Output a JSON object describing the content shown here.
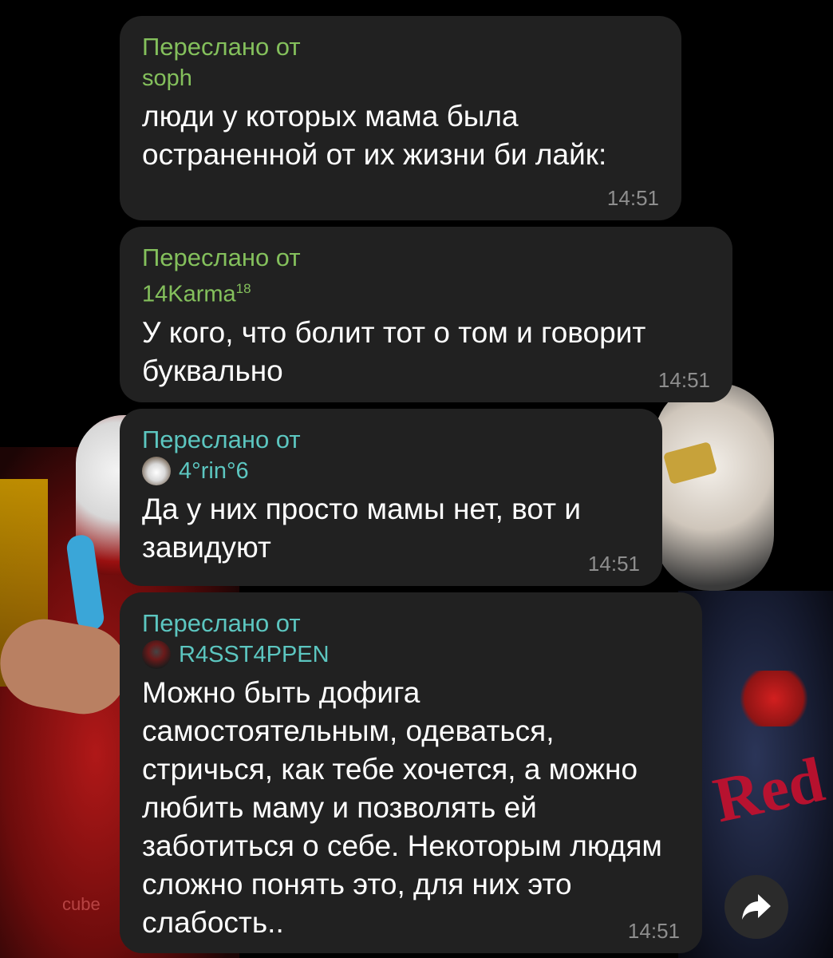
{
  "messages": [
    {
      "forwarded_label": "Переслано от",
      "forwarded_from": "soph",
      "text": "люди у которых мама была остраненной от их жизни би лайк:",
      "time": "14:51"
    },
    {
      "forwarded_label": "Переслано от",
      "forwarded_from": "14Karma",
      "forwarded_from_suffix": "18",
      "text": "У кого, что болит тот о том и говорит буквально",
      "time": "14:51"
    },
    {
      "forwarded_label": "Переслано от",
      "forwarded_from": "4°rin°6",
      "text": "Да у них просто мамы нет, вот и завидуют",
      "time": "14:51"
    },
    {
      "forwarded_label": "Переслано от",
      "forwarded_from": "R4SST4PPEN",
      "text": "Можно быть дофига самостоятельным, одеваться, стричься, как тебе хочется, а можно любить маму и позволять ей заботиться о себе. Некоторым людям сложно понять это, для них это слабость..",
      "time": "14:51"
    }
  ],
  "background": {
    "red_text": "Red",
    "cube_text": "cube"
  },
  "colors": {
    "bubble": "#212121",
    "forward_green": "#84c05c",
    "forward_teal": "#5cc6c0",
    "time": "#8e8e8e"
  },
  "icons": {
    "share": "share-arrow-icon"
  }
}
